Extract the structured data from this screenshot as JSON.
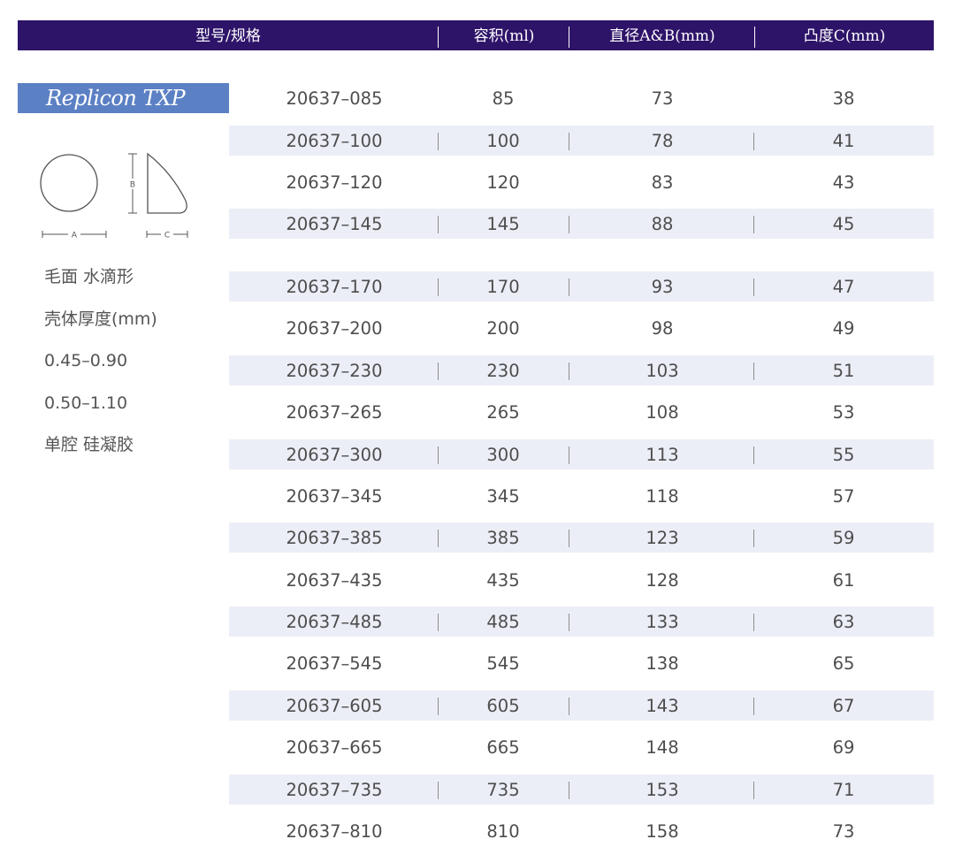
{
  "header": {
    "model": "型号/规格",
    "volume": "容积(ml)",
    "diameter": "直径A&B(mm)",
    "projection": "凸度C(mm)"
  },
  "product": {
    "name": "Replicon TXP",
    "diagram_labels": {
      "a": "A",
      "b": "B",
      "c": "C"
    },
    "notes": [
      "毛面 水滴形",
      "壳体厚度(mm)",
      "0.45–0.90",
      "0.50–1.10",
      "单腔 硅凝胶"
    ]
  },
  "rows": [
    {
      "model": "20637–085",
      "volume": "85",
      "diameter": "73",
      "projection": "38"
    },
    {
      "model": "20637–100",
      "volume": "100",
      "diameter": "78",
      "projection": "41"
    },
    {
      "model": "20637–120",
      "volume": "120",
      "diameter": "83",
      "projection": "43"
    },
    {
      "model": "20637–145",
      "volume": "145",
      "diameter": "88",
      "projection": "45"
    },
    {
      "model": "20637–170",
      "volume": "170",
      "diameter": "93",
      "projection": "47"
    },
    {
      "model": "20637–200",
      "volume": "200",
      "diameter": "98",
      "projection": "49"
    },
    {
      "model": "20637–230",
      "volume": "230",
      "diameter": "103",
      "projection": "51"
    },
    {
      "model": "20637–265",
      "volume": "265",
      "diameter": "108",
      "projection": "53"
    },
    {
      "model": "20637–300",
      "volume": "300",
      "diameter": "113",
      "projection": "55"
    },
    {
      "model": "20637–345",
      "volume": "345",
      "diameter": "118",
      "projection": "57"
    },
    {
      "model": "20637–385",
      "volume": "385",
      "diameter": "123",
      "projection": "59"
    },
    {
      "model": "20637–435",
      "volume": "435",
      "diameter": "128",
      "projection": "61"
    },
    {
      "model": "20637–485",
      "volume": "485",
      "diameter": "133",
      "projection": "63"
    },
    {
      "model": "20637–545",
      "volume": "545",
      "diameter": "138",
      "projection": "65"
    },
    {
      "model": "20637–605",
      "volume": "605",
      "diameter": "143",
      "projection": "67"
    },
    {
      "model": "20637–665",
      "volume": "665",
      "diameter": "148",
      "projection": "69"
    },
    {
      "model": "20637–735",
      "volume": "735",
      "diameter": "153",
      "projection": "71"
    },
    {
      "model": "20637–810",
      "volume": "810",
      "diameter": "158",
      "projection": "73"
    }
  ],
  "colors": {
    "header_bg": "#2e1469",
    "badge_bg": "#5b80c4",
    "row_shade": "#eceef7"
  }
}
